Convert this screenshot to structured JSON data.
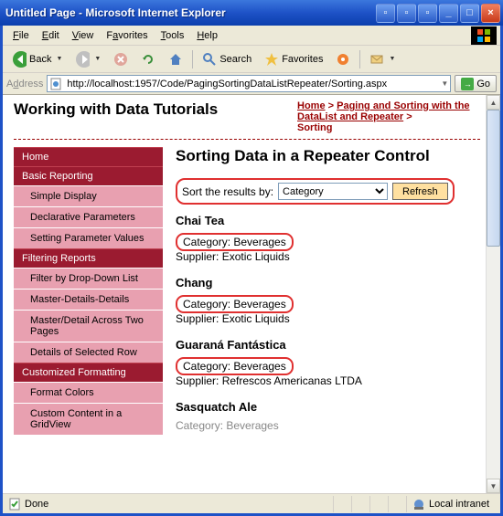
{
  "window": {
    "title": "Untitled Page - Microsoft Internet Explorer"
  },
  "menus": {
    "file": "File",
    "edit": "Edit",
    "view": "View",
    "favorites": "Favorites",
    "tools": "Tools",
    "help": "Help"
  },
  "toolbar": {
    "back": "Back",
    "search": "Search",
    "favorites": "Favorites"
  },
  "address": {
    "label": "Address",
    "url": "http://localhost:1957/Code/PagingSortingDataListRepeater/Sorting.aspx",
    "go": "Go"
  },
  "page": {
    "site_title": "Working with Data Tutorials",
    "breadcrumb": {
      "home": "Home",
      "section": "Paging and Sorting with the DataList and Repeater",
      "current": "Sorting"
    },
    "heading": "Sorting Data in a Repeater Control",
    "sort": {
      "label": "Sort the results by:",
      "options": [
        "Category"
      ],
      "selected": "Category",
      "refresh": "Refresh"
    },
    "products": [
      {
        "name": "Chai Tea",
        "category": "Beverages",
        "supplier": "Exotic Liquids",
        "highlight": true
      },
      {
        "name": "Chang",
        "category": "Beverages",
        "supplier": "Exotic Liquids",
        "highlight": true
      },
      {
        "name": "Guaraná Fantástica",
        "category": "Beverages",
        "supplier": "Refrescos Americanas LTDA",
        "highlight": true
      },
      {
        "name": "Sasquatch Ale",
        "category": "Beverages",
        "supplier": "",
        "highlight": false
      }
    ],
    "cat_prefix": "Category: ",
    "sup_prefix": "Supplier: "
  },
  "sidebar": [
    {
      "type": "section",
      "label": "Home"
    },
    {
      "type": "section",
      "label": "Basic Reporting"
    },
    {
      "type": "item",
      "label": "Simple Display"
    },
    {
      "type": "item",
      "label": "Declarative Parameters"
    },
    {
      "type": "item",
      "label": "Setting Parameter Values"
    },
    {
      "type": "section",
      "label": "Filtering Reports"
    },
    {
      "type": "item",
      "label": "Filter by Drop-Down List"
    },
    {
      "type": "item",
      "label": "Master-Details-Details"
    },
    {
      "type": "item",
      "label": "Master/Detail Across Two Pages"
    },
    {
      "type": "item",
      "label": "Details of Selected Row"
    },
    {
      "type": "section",
      "label": "Customized Formatting"
    },
    {
      "type": "item",
      "label": "Format Colors"
    },
    {
      "type": "item",
      "label": "Custom Content in a GridView"
    }
  ],
  "status": {
    "done": "Done",
    "zone": "Local intranet"
  }
}
